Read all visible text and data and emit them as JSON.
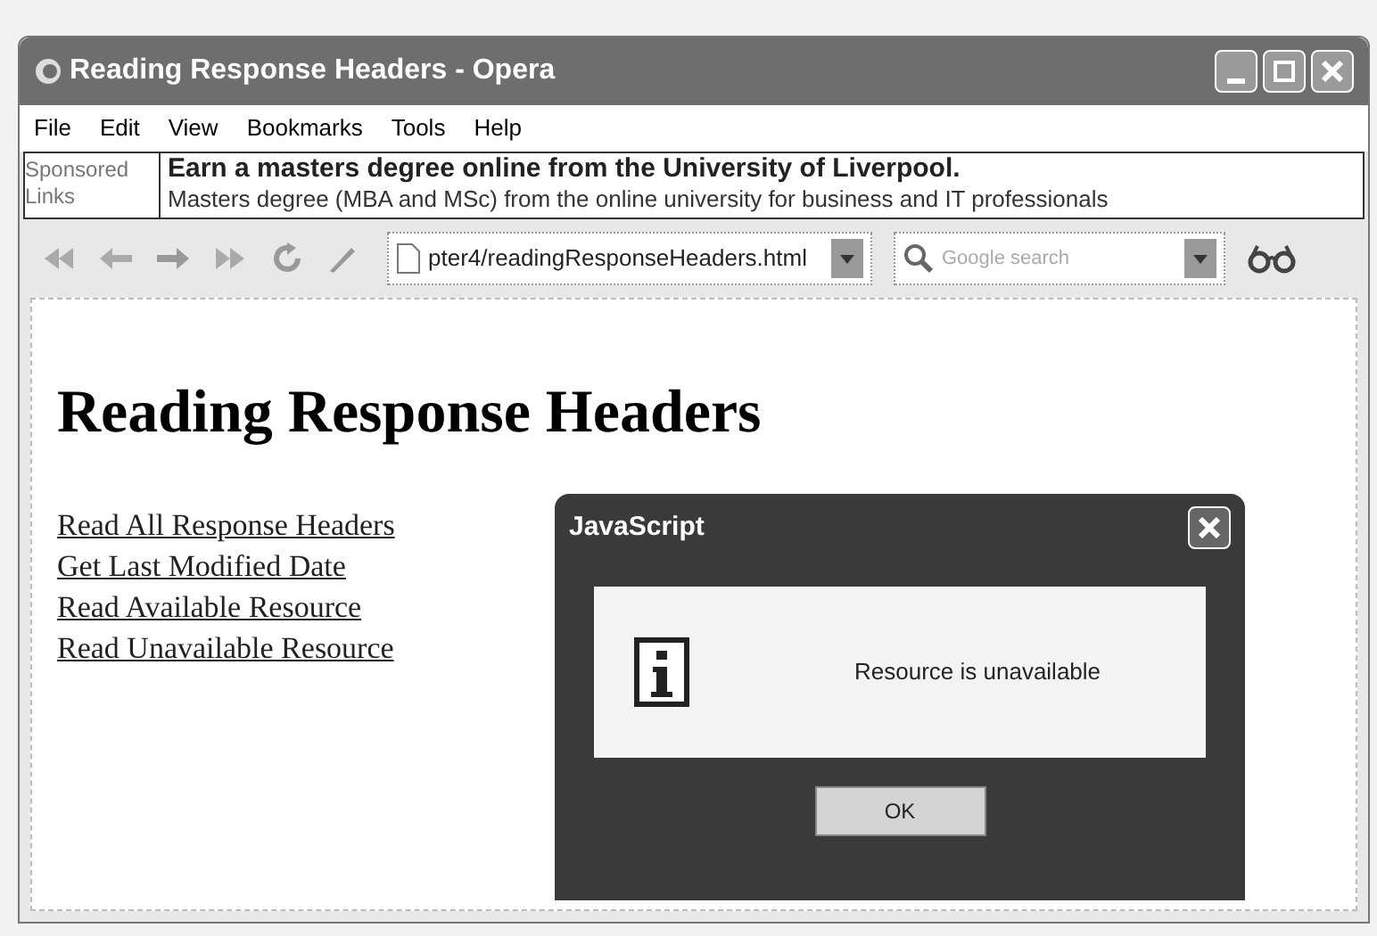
{
  "window": {
    "title": "Reading Response Headers - Opera"
  },
  "menu": [
    "File",
    "Edit",
    "View",
    "Bookmarks",
    "Tools",
    "Help"
  ],
  "sponsored": {
    "label_lines": [
      "Sponsored",
      "Links"
    ],
    "headline": "Earn a masters degree online from the University of Liverpool.",
    "text": "Masters degree (MBA and MSc) from the online university for business and IT professionals"
  },
  "address_bar": {
    "value": "pter4/readingResponseHeaders.html"
  },
  "search": {
    "placeholder": "Google search"
  },
  "page": {
    "heading": "Reading Response Headers",
    "links": [
      "Read All Response Headers",
      "Get Last Modified Date",
      "Read Available Resource",
      "Read Unavailable Resource"
    ]
  },
  "dialog": {
    "title": "JavaScript",
    "message": "Resource is unavailable",
    "button": "OK"
  }
}
